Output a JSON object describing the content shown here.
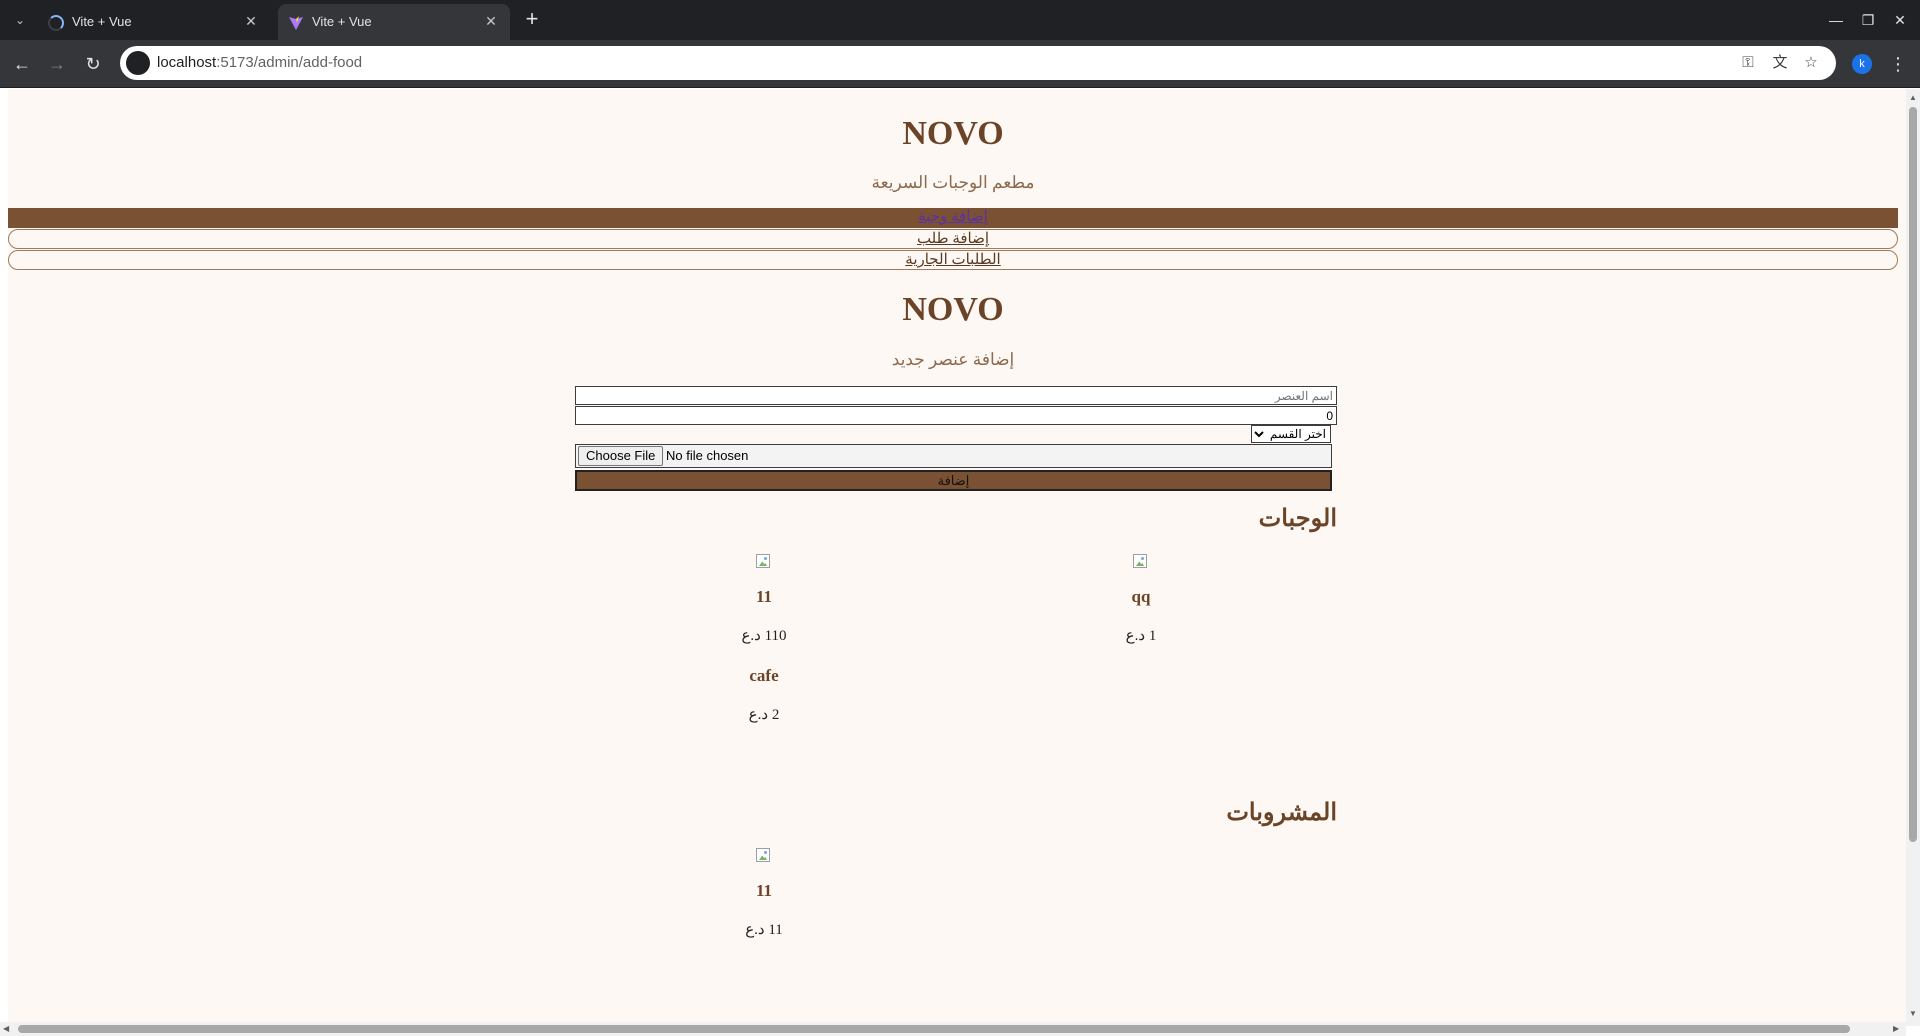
{
  "browser": {
    "tabs": [
      {
        "title": "Vite + Vue",
        "close": "✕"
      },
      {
        "title": "Vite + Vue",
        "close": "✕"
      }
    ],
    "new_tab": "+",
    "url_host": "localhost",
    "url_path": ":5173/admin/add-food",
    "profile_initial": "k"
  },
  "header": {
    "brand": "NOVO",
    "tagline": "مطعم الوجبات السريعة"
  },
  "nav": [
    {
      "label": "إضافة وجبة"
    },
    {
      "label": "إضافة طلب"
    },
    {
      "label": "الطلبات الجارية"
    }
  ],
  "main": {
    "brand": "NOVO",
    "subtitle": "إضافة عنصر جديد"
  },
  "form": {
    "name_placeholder": "اسم العنصر",
    "price_value": "0",
    "category_selected": "اختر القسم",
    "file_button": "Choose File",
    "file_status": "No file chosen",
    "submit_label": "إضافة"
  },
  "sections": {
    "meals": {
      "title": "الوجبات",
      "items": [
        {
          "name": "qq",
          "price": "1 د.ع"
        },
        {
          "name": "11",
          "price": "110 د.ع"
        },
        {
          "name": "cafe",
          "price": "2 د.ع"
        }
      ]
    },
    "drinks": {
      "title": "المشروبات",
      "items": [
        {
          "name": "11",
          "price": "11 د.ع"
        }
      ]
    }
  },
  "colors": {
    "brand_brown": "#6b4428",
    "nav_active_bg": "#7a5233",
    "page_bg": "#fdf8f4"
  }
}
